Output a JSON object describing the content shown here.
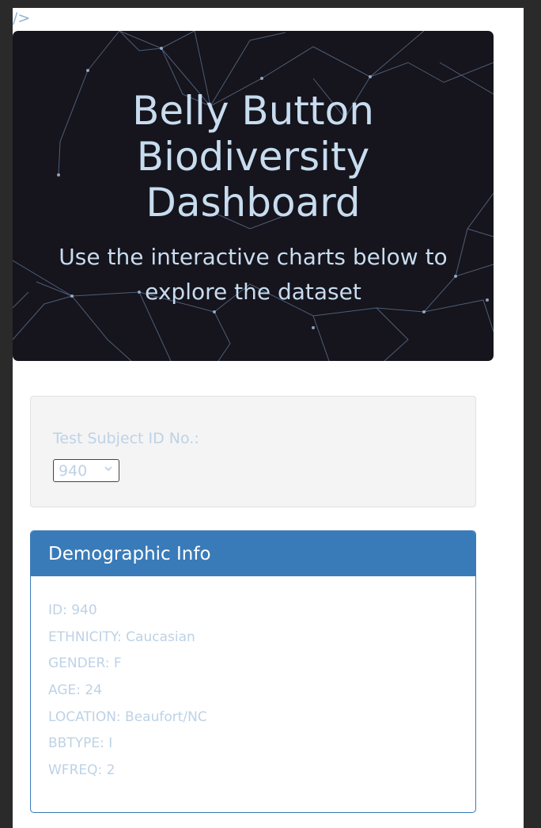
{
  "stray_text": "/>",
  "jumbotron": {
    "title_lines": [
      "Belly Button",
      "Biodiversity",
      "Dashboard"
    ],
    "subtitle_lines": [
      "Use the interactive charts below to",
      "explore the dataset"
    ]
  },
  "selector": {
    "label": "Test Subject ID No.:",
    "value": "940"
  },
  "demographics": {
    "heading": "Demographic Info",
    "lines": [
      "ID: 940",
      "ETHNICITY: Caucasian",
      "GENDER: F",
      "AGE: 24",
      "LOCATION: Beaufort/NC",
      "BBTYPE: I",
      "WFREQ: 2"
    ]
  },
  "colors": {
    "accent": "#397bb9",
    "muted_text": "#bdd2e6",
    "hero_bg": "#16141c",
    "hero_text": "#c7dcef"
  },
  "icons": {
    "select_caret": "chevron-down-icon",
    "hero_background": "network-graph-background"
  }
}
